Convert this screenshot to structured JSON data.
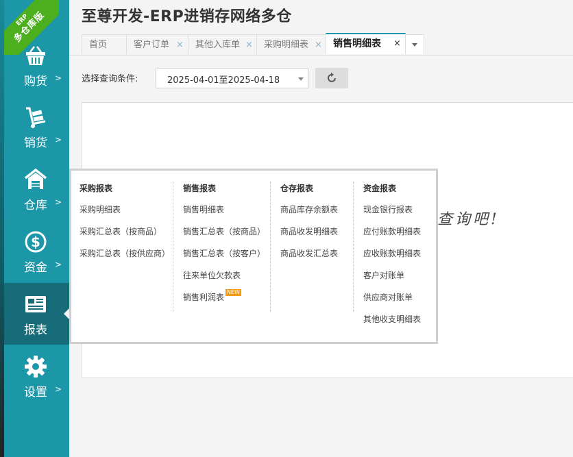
{
  "brand": {
    "ribbon_small": "ERP",
    "ribbon_big": "多仓库版"
  },
  "app": {
    "title": "至尊开发-ERP进销存网络多仓"
  },
  "sidebar": {
    "items": [
      {
        "label": "购货",
        "icon": "shopping-basket-icon"
      },
      {
        "label": "销货",
        "icon": "hand-truck-icon"
      },
      {
        "label": "仓库",
        "icon": "warehouse-icon"
      },
      {
        "label": "资金",
        "icon": "dollar-icon"
      },
      {
        "label": "报表",
        "icon": "report-icon",
        "active": true
      },
      {
        "label": "设置",
        "icon": "gear-icon"
      }
    ],
    "chevron": ">"
  },
  "tabs": [
    {
      "label": "首页",
      "closable": false
    },
    {
      "label": "客户订单",
      "closable": true
    },
    {
      "label": "其他入库单",
      "closable": true
    },
    {
      "label": "采购明细表",
      "closable": true
    },
    {
      "label": "销售明细表",
      "closable": true,
      "active": true
    }
  ],
  "tab_close_glyph": "×",
  "query": {
    "label": "选择查询条件:",
    "date_range": "2025-04-01至2025-04-18"
  },
  "panel": {
    "message_fragment": "击查询吧!"
  },
  "report_menu": {
    "columns": [
      {
        "heading": "采购报表",
        "items": [
          "采购明细表",
          "采购汇总表（按商品）",
          "采购汇总表（按供应商）"
        ]
      },
      {
        "heading": "销售报表",
        "items": [
          "销售明细表",
          "销售汇总表（按商品）",
          "销售汇总表（按客户）",
          "往来单位欠款表",
          "销售利润表"
        ],
        "new_item": "销售利润表"
      },
      {
        "heading": "仓存报表",
        "items": [
          "商品库存余额表",
          "商品收发明细表",
          "商品收发汇总表"
        ]
      },
      {
        "heading": "资金报表",
        "items": [
          "现金银行报表",
          "应付账款明细表",
          "应收账款明细表",
          "客户对账单",
          "供应商对账单",
          "其他收支明细表"
        ]
      }
    ],
    "new_badge": "NEW"
  },
  "colors": {
    "sidebar": "#1c97a8",
    "sidebar_active": "#176c7a",
    "ribbon": "#4caf1e",
    "badge": "#f39c12"
  }
}
